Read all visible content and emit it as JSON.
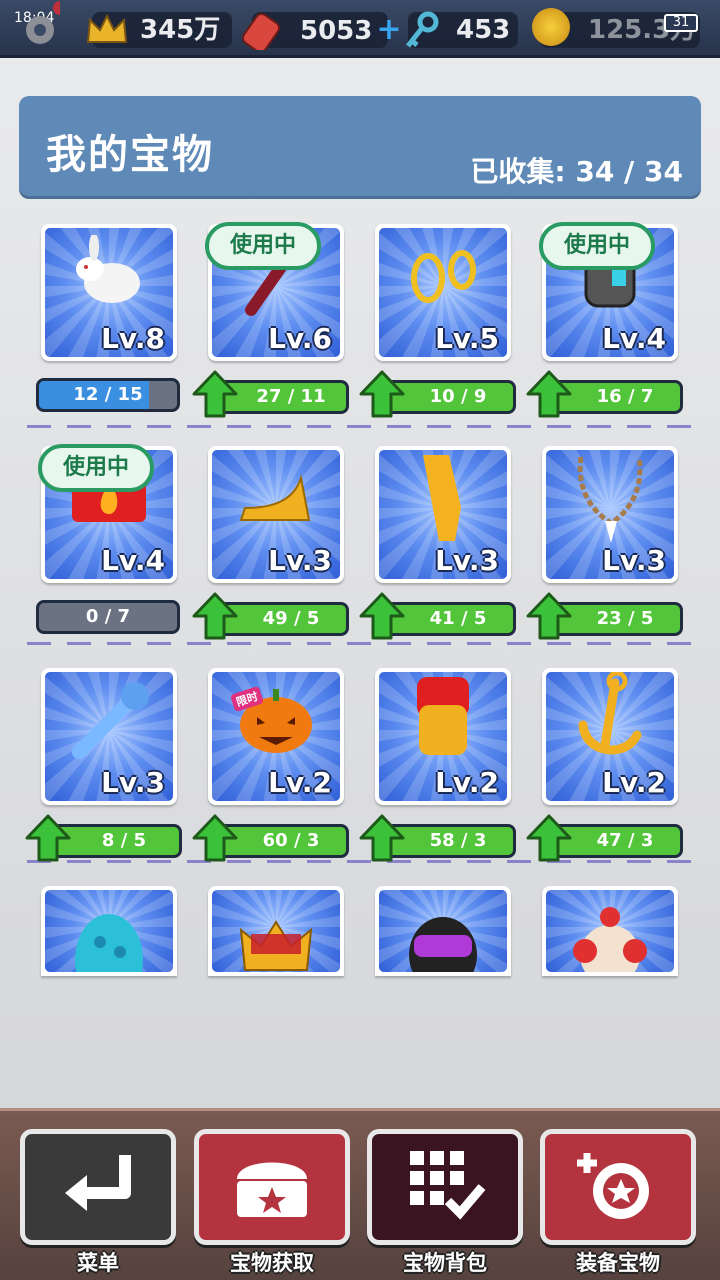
{
  "status_bar": {
    "time": "18:04",
    "battery": "31"
  },
  "topbar": {
    "crowns": "345万",
    "tickets": "5053",
    "keys": "453",
    "coins": "125.3万"
  },
  "header": {
    "title": "我的宝物",
    "collected": "已收集: 34 / 34"
  },
  "items": [
    {
      "name": "rabbit",
      "level": "Lv.8",
      "progress": "12 / 15",
      "in_use": false,
      "upgradeable": false,
      "fill": 0.8
    },
    {
      "name": "staff",
      "level": "Lv.6",
      "progress": "27 / 11",
      "in_use": true,
      "upgradeable": true
    },
    {
      "name": "rings",
      "level": "Lv.5",
      "progress": "10 / 9",
      "in_use": false,
      "upgradeable": true
    },
    {
      "name": "device",
      "level": "Lv.4",
      "progress": "16 / 7",
      "in_use": true,
      "upgradeable": true
    },
    {
      "name": "fire-badge",
      "level": "Lv.4",
      "progress": "0 / 7",
      "in_use": true,
      "upgradeable": false,
      "fill": 0
    },
    {
      "name": "horn",
      "level": "Lv.3",
      "progress": "49 / 5",
      "in_use": false,
      "upgradeable": true
    },
    {
      "name": "golden-shard",
      "level": "Lv.3",
      "progress": "41 / 5",
      "in_use": false,
      "upgradeable": true
    },
    {
      "name": "necklace",
      "level": "Lv.3",
      "progress": "23 / 5",
      "in_use": false,
      "upgradeable": true
    },
    {
      "name": "wrench",
      "level": "Lv.3",
      "progress": "8 / 5",
      "in_use": false,
      "upgradeable": true
    },
    {
      "name": "pumpkin",
      "level": "Lv.2",
      "progress": "60 / 3",
      "in_use": false,
      "upgradeable": true,
      "badge": "限时"
    },
    {
      "name": "idol",
      "level": "Lv.2",
      "progress": "58 / 3",
      "in_use": false,
      "upgradeable": true
    },
    {
      "name": "anchor",
      "level": "Lv.2",
      "progress": "47 / 3",
      "in_use": false,
      "upgradeable": true
    },
    {
      "name": "egg",
      "level": "",
      "progress": "",
      "in_use": false,
      "upgradeable": false
    },
    {
      "name": "crown",
      "level": "",
      "progress": "",
      "in_use": false,
      "upgradeable": false
    },
    {
      "name": "helmet",
      "level": "",
      "progress": "",
      "in_use": false,
      "upgradeable": false
    },
    {
      "name": "clown",
      "level": "",
      "progress": "",
      "in_use": false,
      "upgradeable": false
    }
  ],
  "in_use_label": "使用中",
  "nav": [
    {
      "label": "菜单",
      "icon": "return-icon",
      "color": "#3a3a3a"
    },
    {
      "label": "宝物获取",
      "icon": "chest-icon",
      "color": "#b3343f"
    },
    {
      "label": "宝物背包",
      "icon": "grid-check-icon",
      "color": "#3a1420"
    },
    {
      "label": "装备宝物",
      "icon": "equip-icon",
      "color": "#b3343f"
    }
  ],
  "colors": {
    "header": "#5f89b6",
    "upgrade": "#53c53a",
    "in_use_border": "#2a9b63"
  }
}
